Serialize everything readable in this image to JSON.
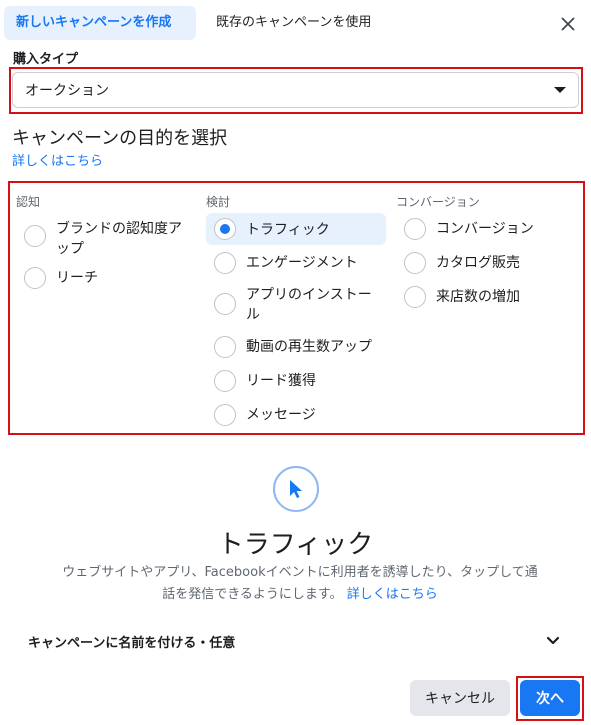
{
  "tabs": [
    {
      "label": "新しいキャンペーンを作成"
    },
    {
      "label": "既存のキャンペーンを使用"
    }
  ],
  "buying_type": {
    "label": "購入タイプ",
    "value": "オークション"
  },
  "objective": {
    "title": "キャンペーンの目的を選択",
    "learn_more": "詳しくはこちら",
    "columns": [
      {
        "heading": "認知",
        "options": [
          "ブランドの認知度アップ",
          "リーチ"
        ]
      },
      {
        "heading": "検討",
        "options": [
          "トラフィック",
          "エンゲージメント",
          "アプリのインストール",
          "動画の再生数アップ",
          "リード獲得",
          "メッセージ"
        ]
      },
      {
        "heading": "コンバージョン",
        "options": [
          "コンバージョン",
          "カタログ販売",
          "来店数の増加"
        ]
      }
    ],
    "selected": "トラフィック"
  },
  "info": {
    "title": "トラフィック",
    "description": "ウェブサイトやアプリ、Facebookイベントに利用者を誘導したり、タップして通話を発信できるようにします。",
    "learn_more": "詳しくはこちら"
  },
  "campaign_name": {
    "label": "キャンペーンに名前を付ける・任意"
  },
  "buttons": {
    "cancel": "キャンセル",
    "next": "次へ"
  },
  "colors": {
    "accent": "#1877f2",
    "highlight": "#d50f16"
  }
}
